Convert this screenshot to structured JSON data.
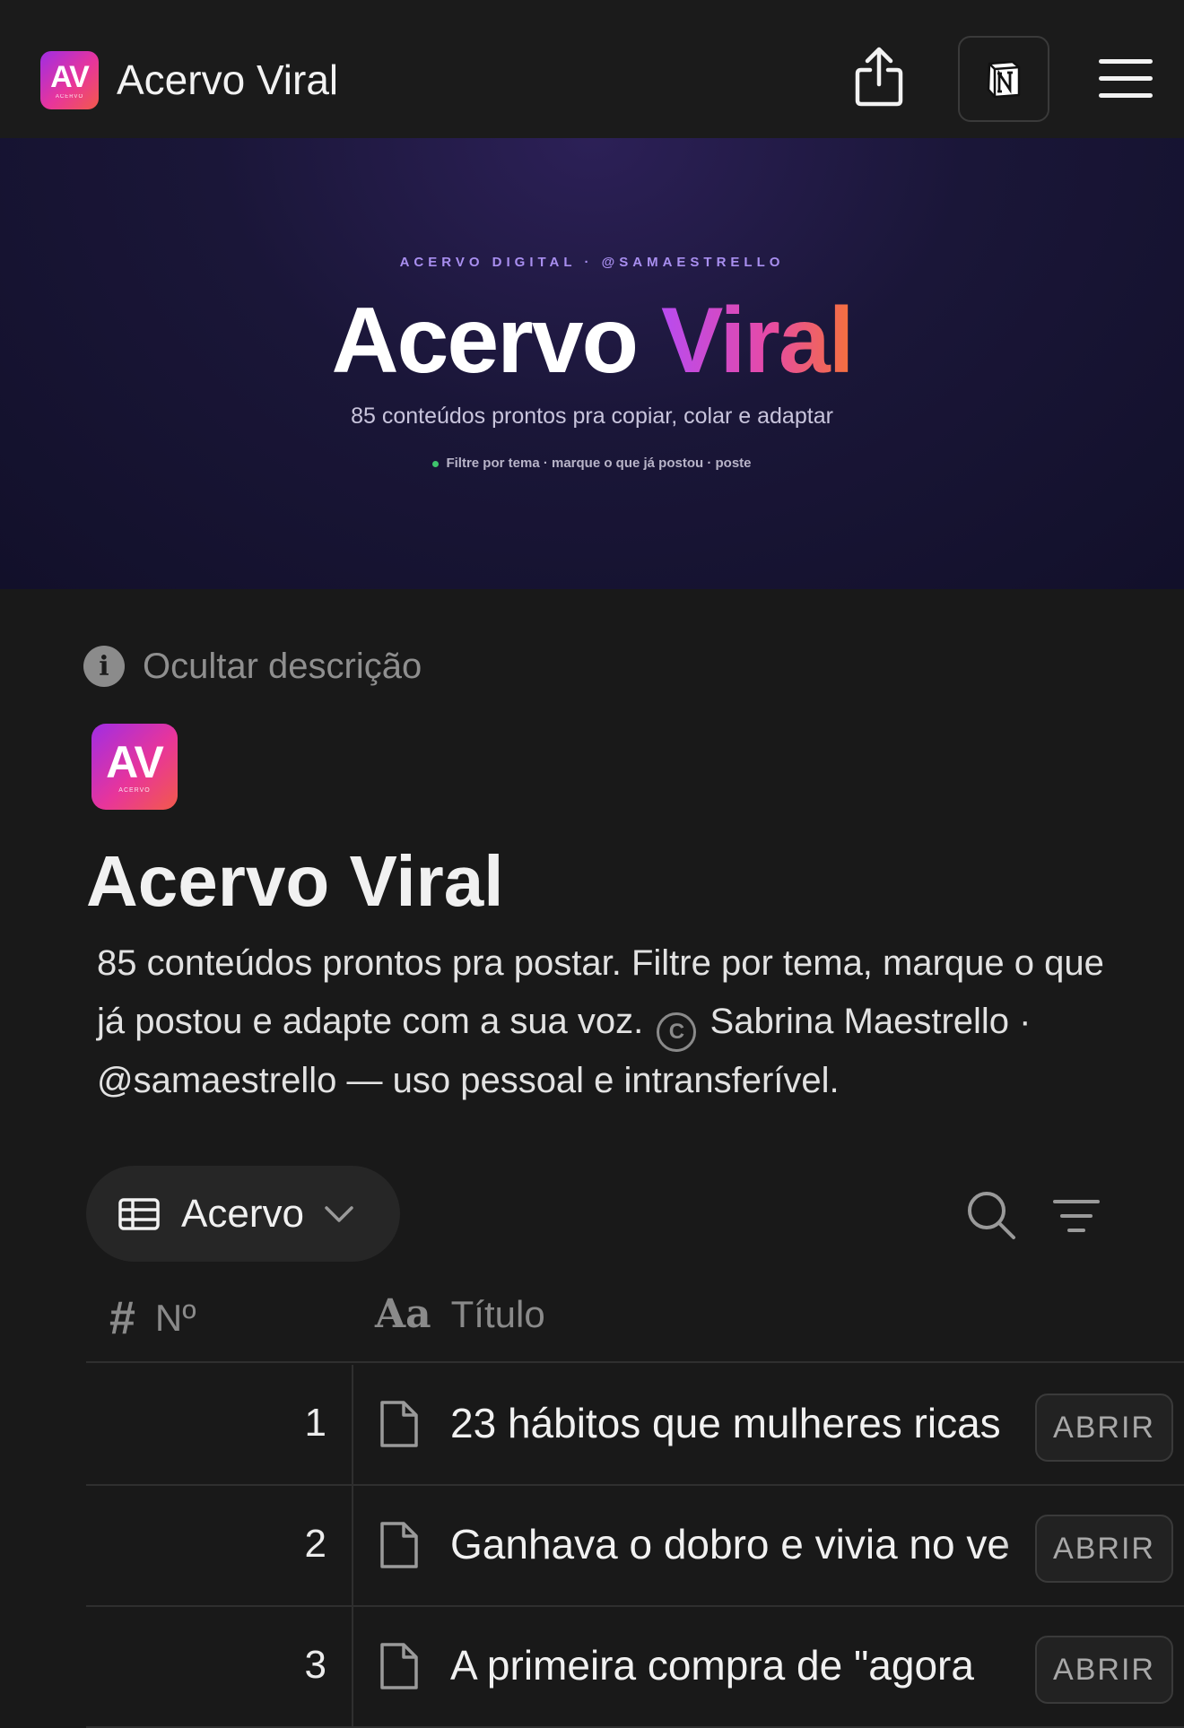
{
  "topbar": {
    "logo_text": "AV",
    "logo_subtext": "ACERVO",
    "title": "Acervo Viral"
  },
  "banner": {
    "kicker": "ACERVO DIGITAL · @SAMAESTRELLO",
    "title_part1": "Acervo",
    "title_part2": "Viral",
    "subtitle": "85 conteúdos prontos pra copiar, colar e adaptar",
    "note": "Filtre por tema · marque o que já postou · poste"
  },
  "page": {
    "hide_description_label": "Ocultar descrição",
    "icon_text": "AV",
    "icon_subtext": "ACERVO",
    "title": "Acervo Viral",
    "description_part1": "85 conteúdos prontos pra postar. Filtre por tema, marque o que já postou e adapte com a sua voz.",
    "copyright_symbol": "C",
    "description_part2": "Sabrina Maestrello · @samaestrello — uso pessoal e intransferível."
  },
  "view": {
    "label": "Acervo"
  },
  "table": {
    "columns": [
      {
        "icon": "#",
        "label": "Nº"
      },
      {
        "icon": "Aa",
        "label": "Título"
      }
    ],
    "open_label": "ABRIR",
    "rows": [
      {
        "num": "1",
        "title": "23 hábitos que mulheres ricas"
      },
      {
        "num": "2",
        "title": "Ganhava o dobro e vivia no ve"
      },
      {
        "num": "3",
        "title": "A primeira compra de \"agora"
      }
    ]
  }
}
